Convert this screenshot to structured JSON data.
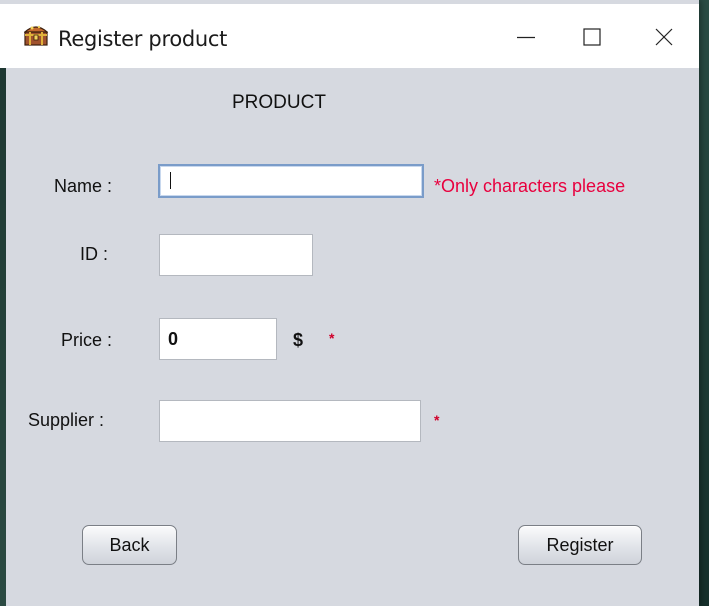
{
  "window": {
    "title": "Register product",
    "minimize_icon": "minimize-icon",
    "maximize_icon": "maximize-icon",
    "close_icon": "close-icon",
    "app_icon": "treasure-chest-icon"
  },
  "form": {
    "heading": "PRODUCT",
    "name": {
      "label": "Name :",
      "value": "",
      "hint": "*Only characters please"
    },
    "id": {
      "label": "ID :",
      "value": ""
    },
    "price": {
      "label": "Price :",
      "value": "0",
      "unit": "$",
      "required_mark": "*"
    },
    "supplier": {
      "label": "Supplier :",
      "value": "",
      "required_mark": "*"
    }
  },
  "buttons": {
    "back": "Back",
    "register": "Register"
  },
  "colors": {
    "hint": "#e8003e",
    "required": "#d0002a",
    "background": "#d6d9e0",
    "focus_border": "#7a9cc9"
  }
}
